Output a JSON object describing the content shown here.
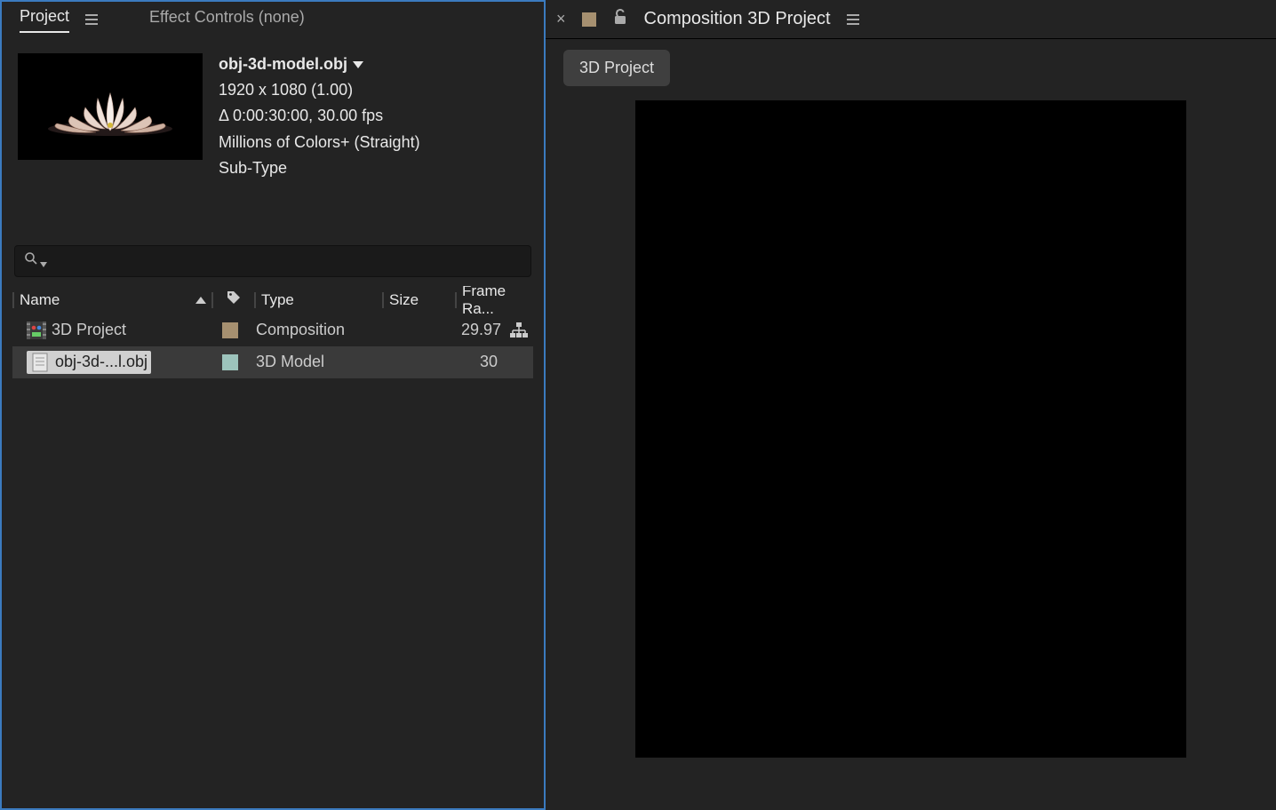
{
  "panel_tabs": {
    "project": "Project",
    "effect_controls": "Effect Controls (none)"
  },
  "preview": {
    "filename": "obj-3d-model.obj",
    "dims": "1920 x 1080 (1.00)",
    "duration": "Δ 0:00:30:00, 30.00 fps",
    "colors": "Millions of Colors+ (Straight)",
    "subtype": "Sub-Type"
  },
  "columns": {
    "name": "Name",
    "type": "Type",
    "size": "Size",
    "frame": "Frame Ra..."
  },
  "rows": [
    {
      "name": "3D Project",
      "type": "Composition",
      "size": "",
      "frame": "29.97",
      "label_color": "#a69070",
      "icon": "comp",
      "selected": false
    },
    {
      "name": "obj-3d-...l.obj",
      "type": "3D Model",
      "size": "",
      "frame": "30",
      "label_color": "#9dc4bc",
      "icon": "file",
      "selected": true
    }
  ],
  "right": {
    "title": "Composition 3D Project",
    "tab": "3D Project"
  }
}
